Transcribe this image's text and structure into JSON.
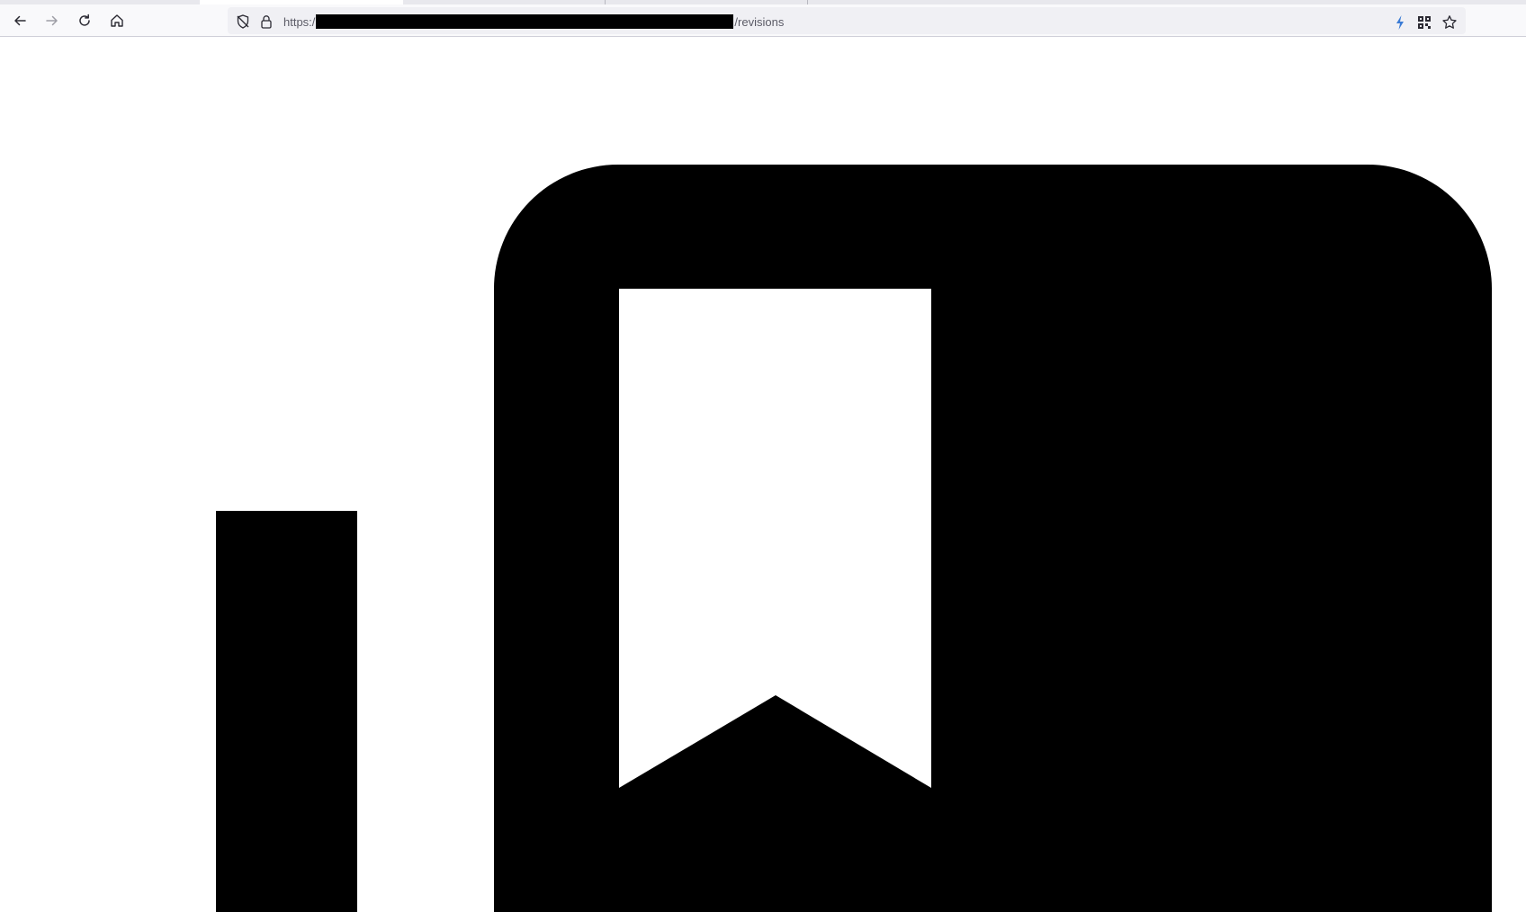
{
  "browser": {
    "url": {
      "prefix": "https:/",
      "suffix": "/revisions"
    },
    "icons": {
      "back": "arrow-left-icon",
      "forward": "arrow-right-icon",
      "reload": "reload-icon",
      "home": "home-icon",
      "tracking_protection": "shield-icon",
      "lock": "lock-icon",
      "extension": "lightning-icon",
      "qr": "qr-code-icon",
      "bookmark": "star-icon"
    },
    "colors": {
      "toolbar_bg": "#f9f9fb",
      "urlbar_bg": "#f0f0f4",
      "accent_blue": "#3a7bd5"
    }
  },
  "page": {
    "graphic": "bookmark-book-icon",
    "fill_color": "#000000"
  }
}
